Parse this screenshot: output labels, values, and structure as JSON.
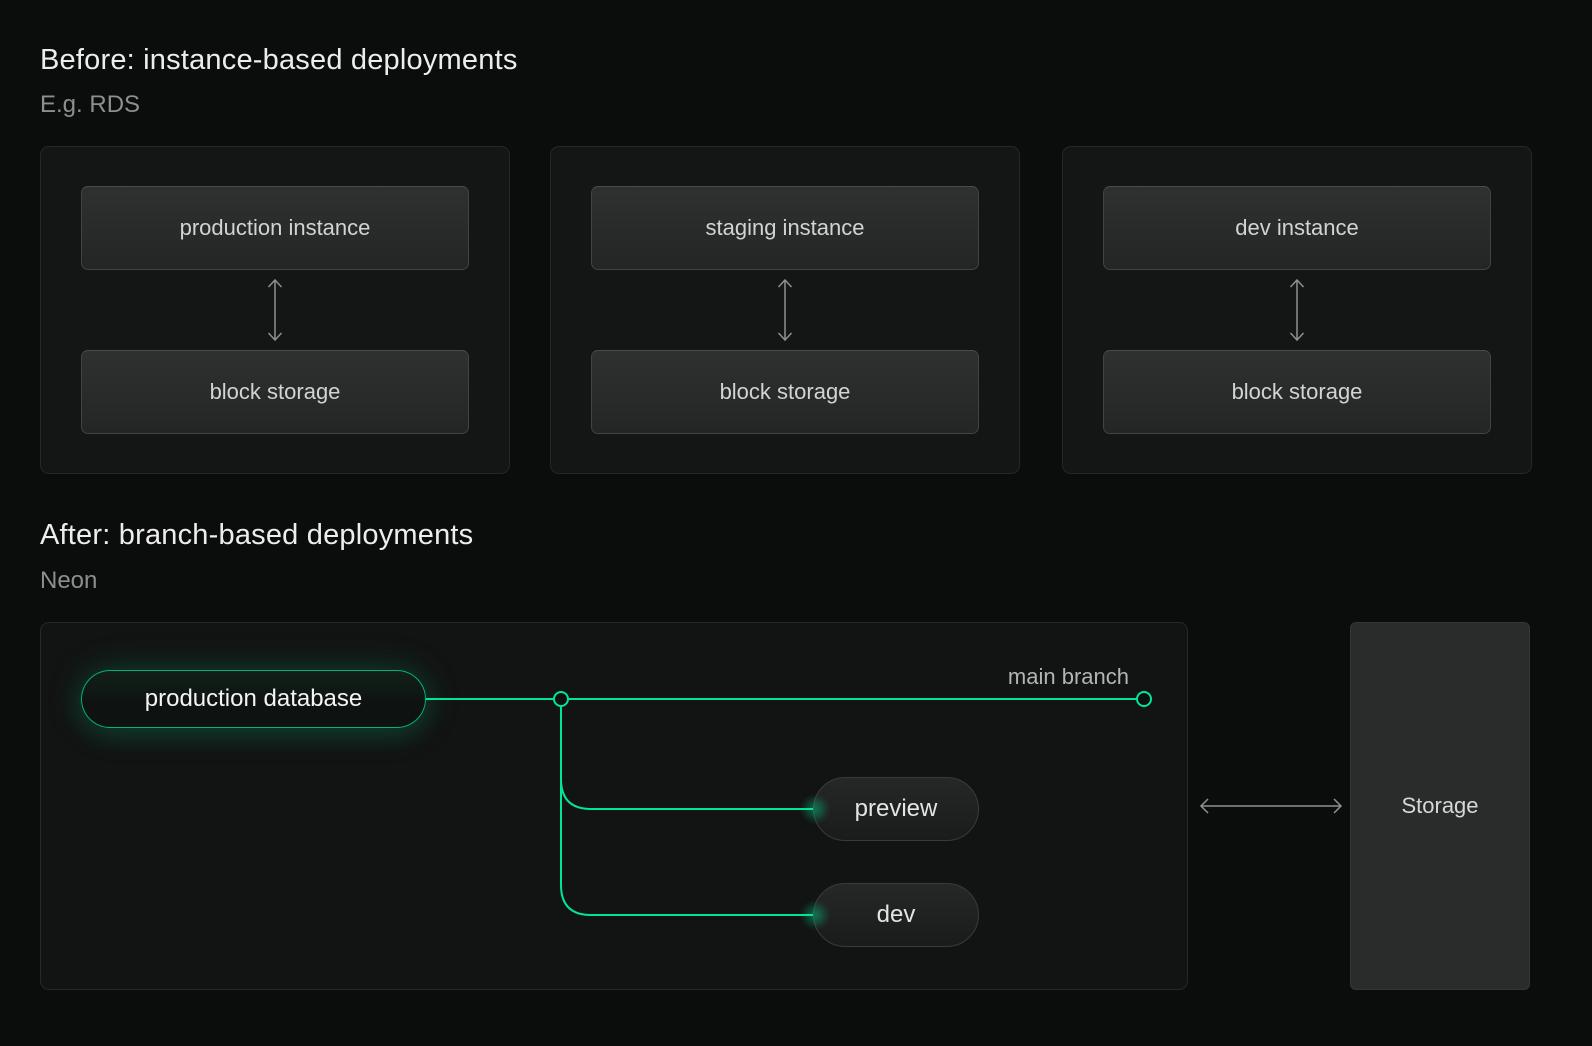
{
  "page": {
    "background_color": "#0b0c0c",
    "accent_green": "#00e599"
  },
  "before": {
    "title": "Before: instance-based deployments",
    "subtitle": "E.g. RDS",
    "cards": [
      {
        "instance_label": "production instance",
        "storage_label": "block storage"
      },
      {
        "instance_label": "staging instance",
        "storage_label": "block storage"
      },
      {
        "instance_label": "dev instance",
        "storage_label": "block storage"
      }
    ]
  },
  "after": {
    "title": "After: branch-based deployments",
    "subtitle": "Neon",
    "production_database_label": "production database",
    "main_branch_label": "main branch",
    "branch_pills": [
      {
        "label": "preview"
      },
      {
        "label": "dev"
      }
    ],
    "storage_label": "Storage"
  }
}
